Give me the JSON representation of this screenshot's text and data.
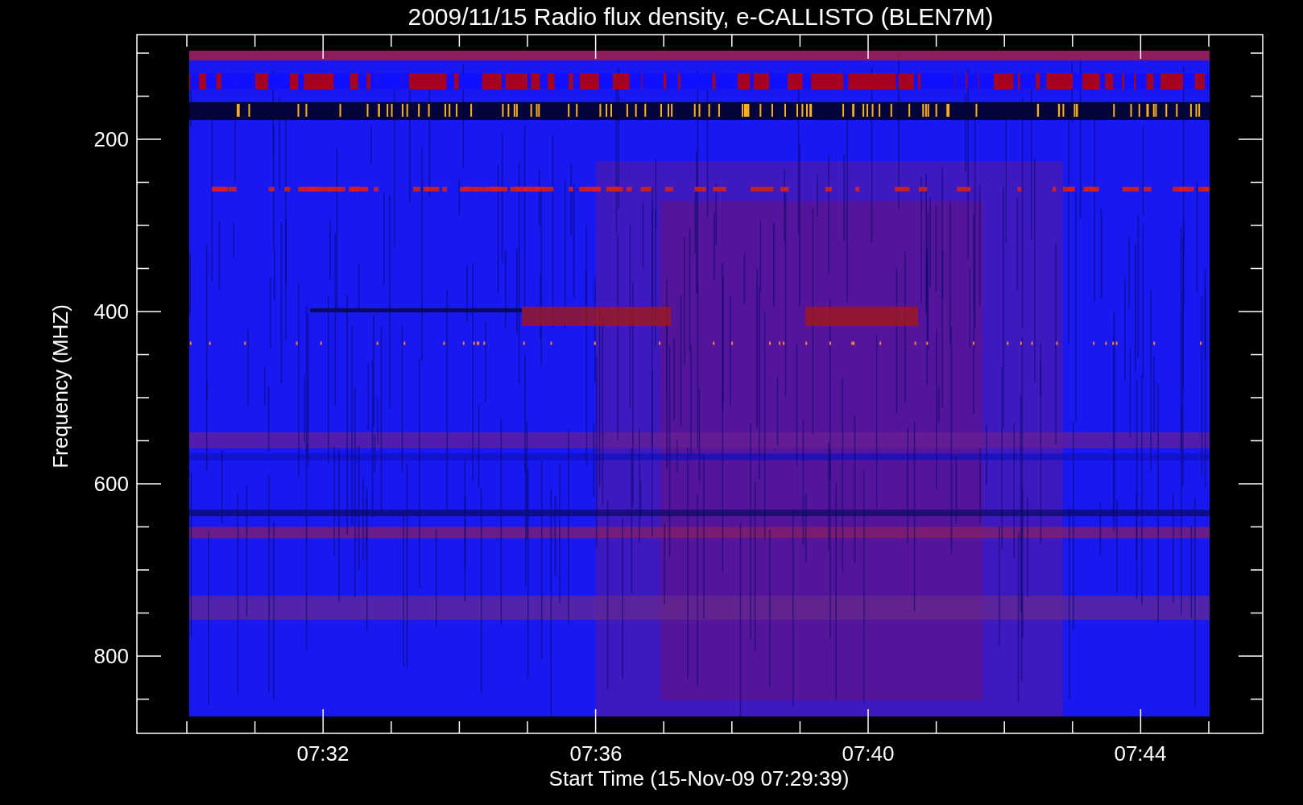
{
  "title": "2009/11/15  Radio flux density, e-CALLISTO (BLEN7M)",
  "y_axis": {
    "label": "Frequency (MHZ)",
    "ticks": [
      "200",
      "400",
      "600",
      "800"
    ]
  },
  "x_axis": {
    "label": "Start Time (15-Nov-09 07:29:39)",
    "ticks": [
      "07:32",
      "07:36",
      "07:40",
      "07:44"
    ]
  }
}
